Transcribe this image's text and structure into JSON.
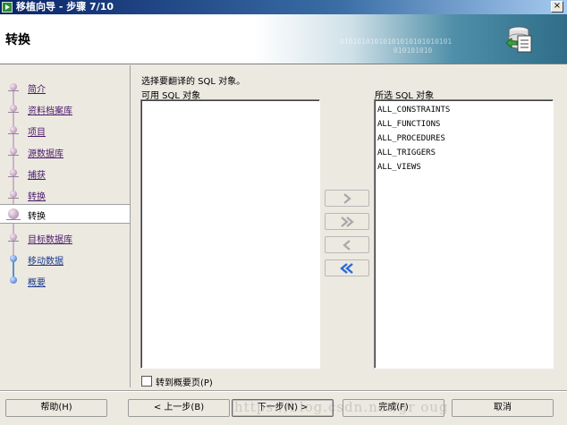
{
  "window": {
    "title": "移植向导 - 步骤 7/10",
    "close_label": "×"
  },
  "header": {
    "title": "转换",
    "binary_1": "01010101010101010101010101",
    "binary_2": "010101010"
  },
  "nav": {
    "items": [
      {
        "label": "简介",
        "state": "done"
      },
      {
        "label": "资料档案库",
        "state": "done"
      },
      {
        "label": "项目",
        "state": "done"
      },
      {
        "label": "源数据库",
        "state": "done"
      },
      {
        "label": "捕获",
        "state": "done"
      },
      {
        "label": "转换",
        "state": "done"
      },
      {
        "label": "转换",
        "state": "current"
      },
      {
        "label": "目标数据库",
        "state": "done"
      },
      {
        "label": "移动数据",
        "state": "pending"
      },
      {
        "label": "概要",
        "state": "pending"
      }
    ]
  },
  "main": {
    "instruction": "选择要翻译的 SQL 对象。",
    "available_label": "可用 SQL 对象",
    "selected_label": "所选 SQL 对象",
    "available_items": [],
    "selected_items": [
      "ALL_CONSTRAINTS",
      "ALL_FUNCTIONS",
      "ALL_PROCEDURES",
      "ALL_TRIGGERS",
      "ALL_VIEWS"
    ],
    "goto_summary_label": "转到概要页(P)"
  },
  "footer": {
    "help": "帮助(H)",
    "back": "< 上一步(B)",
    "next": "下一步(N) >",
    "finish": "完成(F)",
    "cancel": "取消",
    "watermark": "https://blog.csdn.net/gr    oug"
  },
  "colors": {
    "accent": "#2f6d88",
    "title_bar": "#0a246a",
    "move_all_left": "#2a6ad8"
  }
}
